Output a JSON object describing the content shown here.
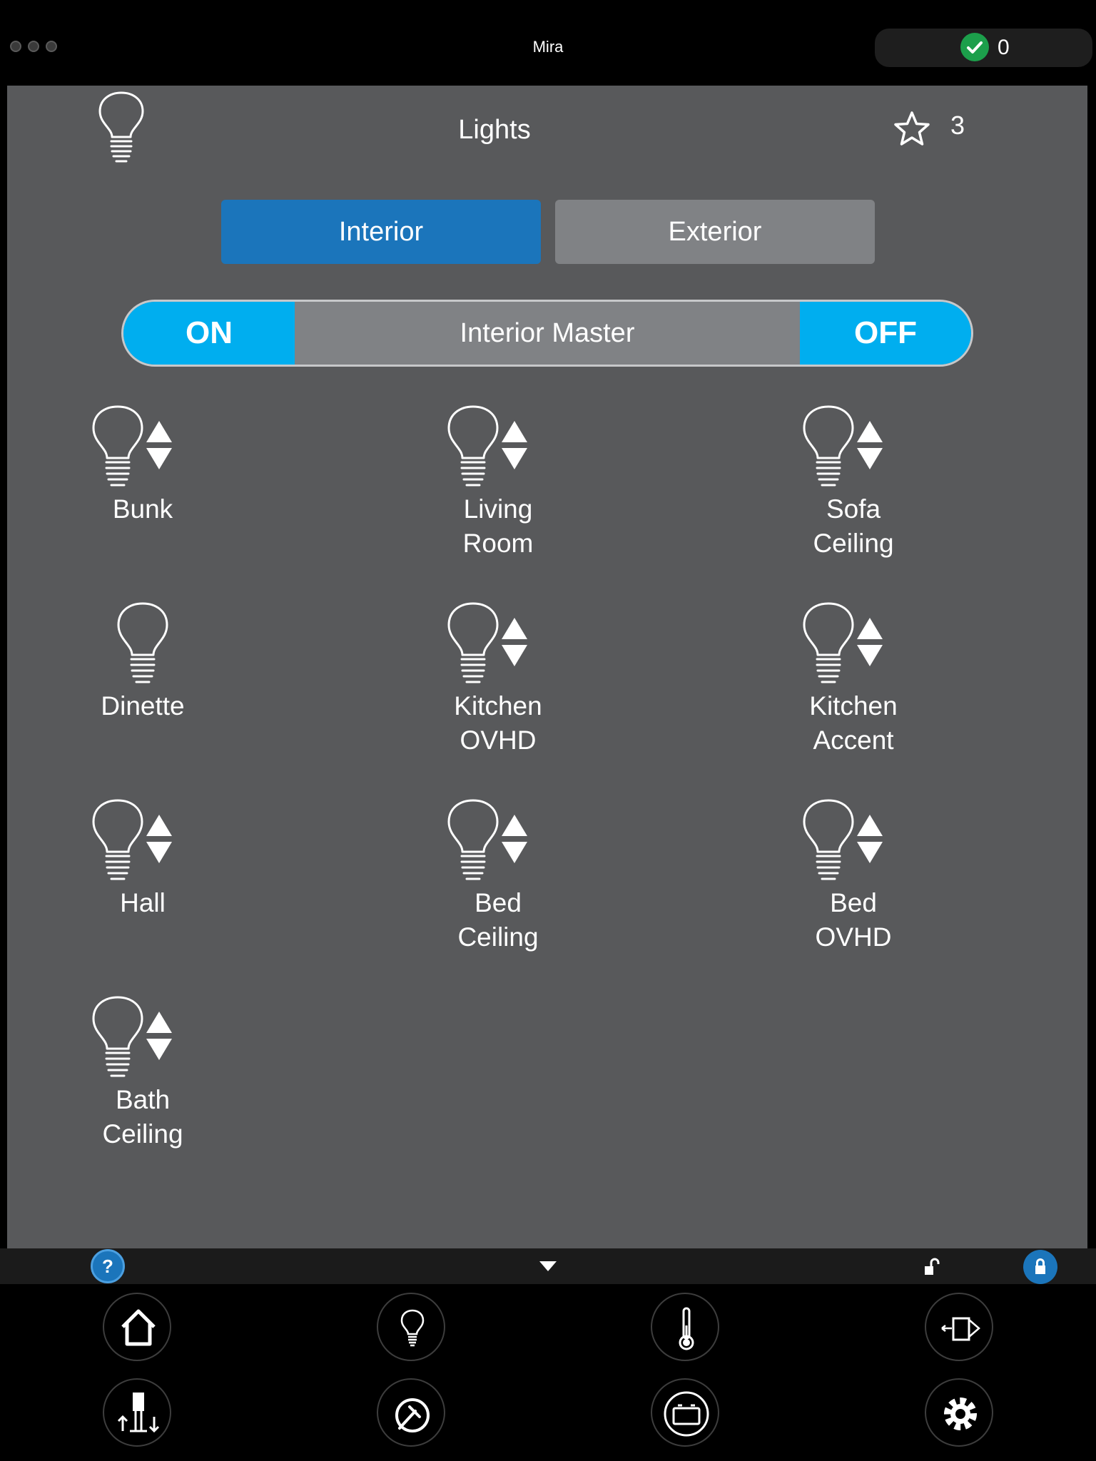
{
  "app": {
    "title": "Mira"
  },
  "status": {
    "count": "0",
    "icon": "check-icon",
    "color": "#1c9f4b"
  },
  "header": {
    "title": "Lights",
    "icon": "lightbulb-icon",
    "favorites_count": "3"
  },
  "tabs": [
    {
      "label": "Interior",
      "active": true
    },
    {
      "label": "Exterior",
      "active": false
    }
  ],
  "master": {
    "on_label": "ON",
    "label": "Interior Master",
    "off_label": "OFF"
  },
  "lights": [
    {
      "lines": [
        "Bunk",
        ""
      ],
      "dimmable": true
    },
    {
      "lines": [
        "Living",
        "Room"
      ],
      "dimmable": true
    },
    {
      "lines": [
        "Sofa",
        "Ceiling"
      ],
      "dimmable": true
    },
    {
      "lines": [
        "Dinette",
        ""
      ],
      "dimmable": false
    },
    {
      "lines": [
        "Kitchen",
        "OVHD"
      ],
      "dimmable": true
    },
    {
      "lines": [
        "Kitchen",
        "Accent"
      ],
      "dimmable": true
    },
    {
      "lines": [
        "Hall",
        ""
      ],
      "dimmable": true
    },
    {
      "lines": [
        "Bed",
        "Ceiling"
      ],
      "dimmable": true
    },
    {
      "lines": [
        "Bed",
        "OVHD"
      ],
      "dimmable": true
    },
    {
      "lines": [
        "Bath",
        "Ceiling"
      ],
      "dimmable": true
    }
  ],
  "bottom_bar": {
    "help_label": "?"
  },
  "nav": [
    {
      "icon": "home-icon"
    },
    {
      "icon": "lightbulb-icon"
    },
    {
      "icon": "thermometer-icon"
    },
    {
      "icon": "slide-out-icon"
    },
    {
      "icon": "leveling-jacks-icon"
    },
    {
      "icon": "generator-icon"
    },
    {
      "icon": "battery-icon"
    },
    {
      "icon": "settings-gear-icon"
    }
  ],
  "colors": {
    "accent_blue": "#1b75bb",
    "cyan": "#00aeef",
    "panel": "#58595b",
    "inactive_tab": "#808285"
  }
}
